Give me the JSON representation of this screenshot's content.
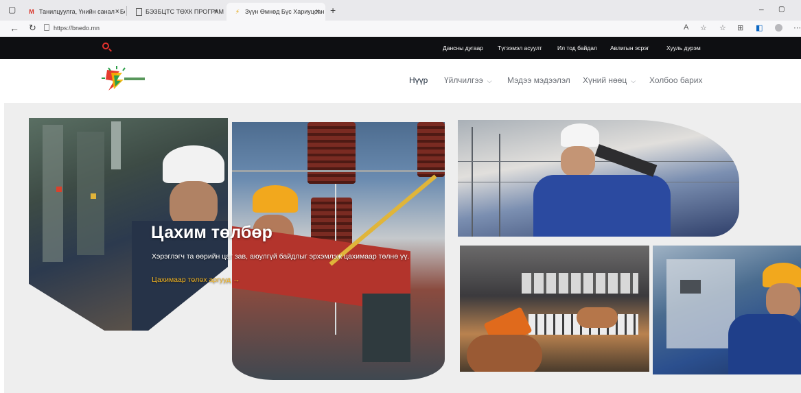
{
  "browser": {
    "tabs": [
      {
        "label": "Танилцуулга, Үнийн санал - Бо",
        "icon": "gmail-icon"
      },
      {
        "label": "БЭЗБЦТС ТӨХК ПРОГРАМ",
        "icon": "document-icon"
      },
      {
        "label": "Зүүн Өмнөд Бүс Хариуцсан Ца",
        "icon": "site-favicon"
      }
    ],
    "new_tab_symbol": "+",
    "close_symbol": "×",
    "url": "https://bnedo.mn",
    "window_controls": {
      "minimize": "–",
      "restore": "▢"
    },
    "toolbar_icons": [
      "read-aloud-icon",
      "favorite-icon",
      "favorites-list-icon",
      "collections-icon",
      "outlook-icon",
      "profile-icon",
      "more-icon"
    ]
  },
  "site": {
    "top_links": [
      "Дансны дугаар",
      "Түгээмэл асуулт",
      "Ил тод байдал",
      "Авлигын эсрэг",
      "Хууль дүрэм"
    ],
    "menu": [
      {
        "label": "Нүүр",
        "active": true,
        "dropdown": false
      },
      {
        "label": "Үйлчилгээ",
        "active": false,
        "dropdown": true
      },
      {
        "label": "Мэдээ мэдээлэл",
        "active": false,
        "dropdown": false
      },
      {
        "label": "Хүний нөөц",
        "active": false,
        "dropdown": true
      },
      {
        "label": "Холбоо барих",
        "active": false,
        "dropdown": false
      }
    ],
    "colors": {
      "topbar": "#0e0f12",
      "accent": "#f1b320",
      "search": "#e5322d"
    }
  },
  "hero": {
    "title": "Цахим төлбөр",
    "subtitle": "Хэрэглэгч та өөрийн цаг зав, аюулгүй байдлыг эрхэмлэж цахимаар төлнө үү.",
    "link": "Цахимаар төлөх аргууд →"
  }
}
